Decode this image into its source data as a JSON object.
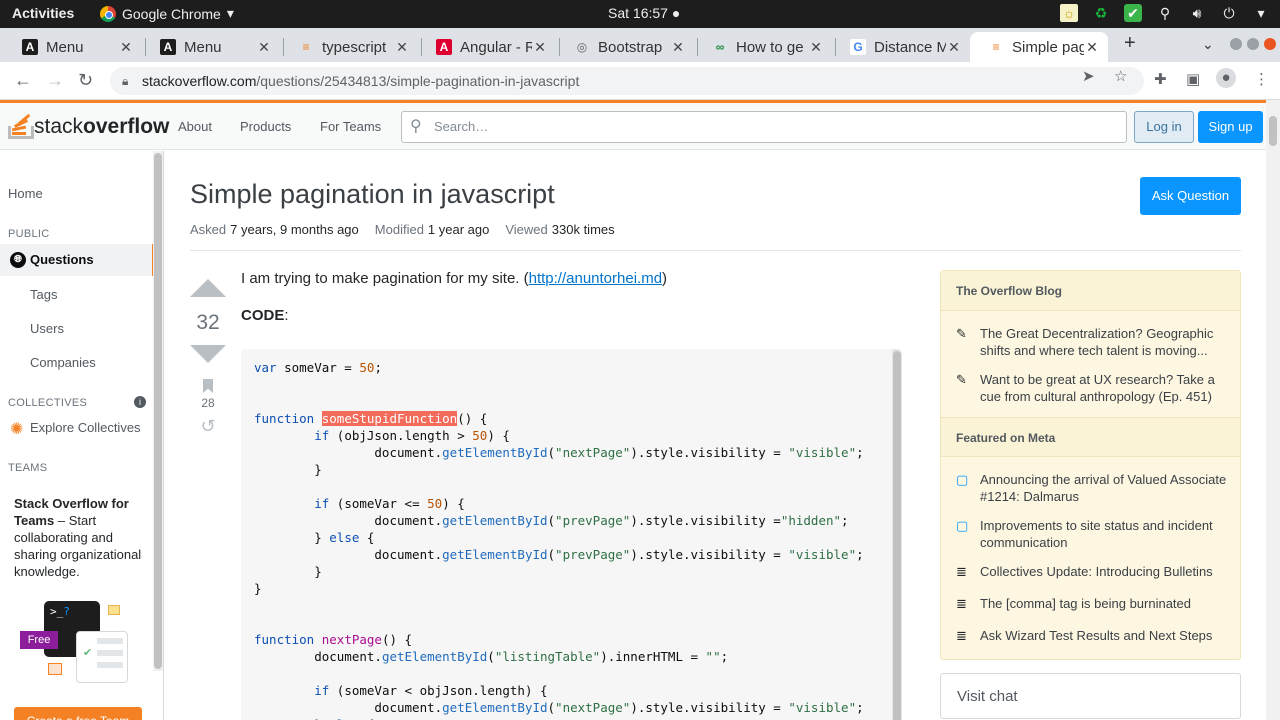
{
  "system": {
    "activities": "Activities",
    "app_name": "Google Chrome",
    "clock": "Sat 16:57 ●"
  },
  "tabs": [
    {
      "title": "Menu",
      "favicon": "A"
    },
    {
      "title": "Menu",
      "favicon": "A"
    },
    {
      "title": "typescript",
      "favicon": "≡"
    },
    {
      "title": "Angular - R",
      "favicon": "A"
    },
    {
      "title": "Bootstrap",
      "favicon": "◎"
    },
    {
      "title": "How to ge",
      "favicon": "∞"
    },
    {
      "title": "Distance M",
      "favicon": "G"
    },
    {
      "title": "Simple pag",
      "favicon": "≡"
    }
  ],
  "address": {
    "domain": "stackoverflow.com",
    "path": "/questions/25434813/simple-pagination-in-javascript"
  },
  "so_header": {
    "logo_stack": "stack",
    "logo_overflow": "overflow",
    "nav": [
      "About",
      "Products",
      "For Teams"
    ],
    "search_placeholder": "Search…",
    "login": "Log in",
    "signup": "Sign up"
  },
  "leftnav": {
    "home": "Home",
    "public_head": "PUBLIC",
    "questions": "Questions",
    "tags": "Tags",
    "users": "Users",
    "companies": "Companies",
    "collectives_head": "COLLECTIVES",
    "explore": "Explore Collectives",
    "teams_head": "TEAMS",
    "teams_bold": "Stack Overflow for Teams",
    "teams_text": " – Start collaborating and sharing organizational knowledge.",
    "teams_free_badge": "Free",
    "free_team_btn": "Create a free Team"
  },
  "question": {
    "title": "Simple pagination in javascript",
    "ask_button": "Ask Question",
    "asked_label": "Asked",
    "asked_value": "7 years, 9 months ago",
    "modified_label": "Modified",
    "modified_value": "1 year ago",
    "viewed_label": "Viewed",
    "viewed_value": "330k times",
    "votes": "32",
    "bookmarks": "28",
    "intro_text": "I am trying to make pagination for my site. (",
    "intro_link": "http://anuntorhei.md",
    "intro_close": ")",
    "code_label": "CODE",
    "code_colon": ":"
  },
  "sidebar": {
    "blog_head": "The Overflow Blog",
    "blog_items": [
      "The Great Decentralization? Geographic shifts and where tech talent is moving...",
      "Want to be great at UX research? Take a cue from cultural anthropology (Ep. 451)"
    ],
    "meta_head": "Featured on Meta",
    "meta_items": [
      "Announcing the arrival of Valued Associate #1214: Dalmarus",
      "Improvements to site status and incident communication",
      "Collectives Update: Introducing Bulletins",
      "The [comma] tag is being burninated",
      "Ask Wizard Test Results and Next Steps"
    ],
    "visit_chat": "Visit chat"
  },
  "colors": {
    "so_orange": "#f48225",
    "so_blue": "#0a95ff",
    "blog_bg": "#fdf7e2"
  }
}
